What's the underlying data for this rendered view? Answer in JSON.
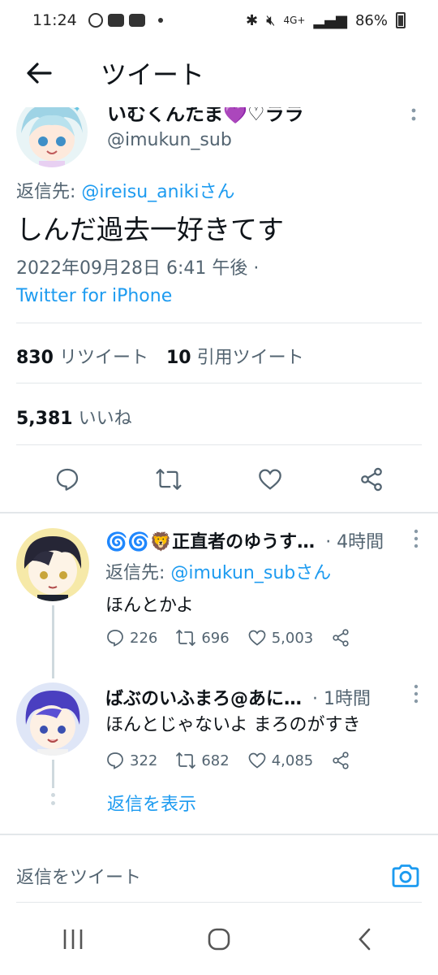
{
  "status_bar": {
    "time": "11:24",
    "network": "4G+",
    "battery": "86%"
  },
  "header": {
    "title": "ツイート"
  },
  "tweet": {
    "author_name": "いむくんたま💜♡ララ",
    "author_handle": "@imukun_sub",
    "reply_prefix": "返信先:",
    "reply_handle": "@ireisu_anikiさん",
    "text": "しんだ過去一好きてす",
    "datetime": "2022年09月28日 6:41 午後 ·",
    "source": "Twitter for iPhone",
    "retweets_count": "830",
    "retweets_label": "リツイート",
    "quotes_count": "10",
    "quotes_label": "引用ツイート",
    "likes_count": "5,381",
    "likes_label": "いいね"
  },
  "replies": [
    {
      "name": "🌀🌀🦁正直者のゆうす…",
      "time": "· 4時間",
      "reply_prefix": "返信先:",
      "reply_handle": "@imukun_subさん",
      "text": "ほんとかよ",
      "replies": "226",
      "retweets": "696",
      "likes": "5,003"
    },
    {
      "name": "ばぶのいふまろ@あに…",
      "time": "· 1時間",
      "text": "ほんとじゃないよ まろのがすき",
      "replies": "322",
      "retweets": "682",
      "likes": "4,085"
    }
  ],
  "show_replies": "返信を表示",
  "compose": {
    "placeholder": "返信をツイート"
  },
  "colors": {
    "accent": "#1d9bf0",
    "text": "#0f1419",
    "secondary": "#536471",
    "divider": "#e3e7ea"
  }
}
